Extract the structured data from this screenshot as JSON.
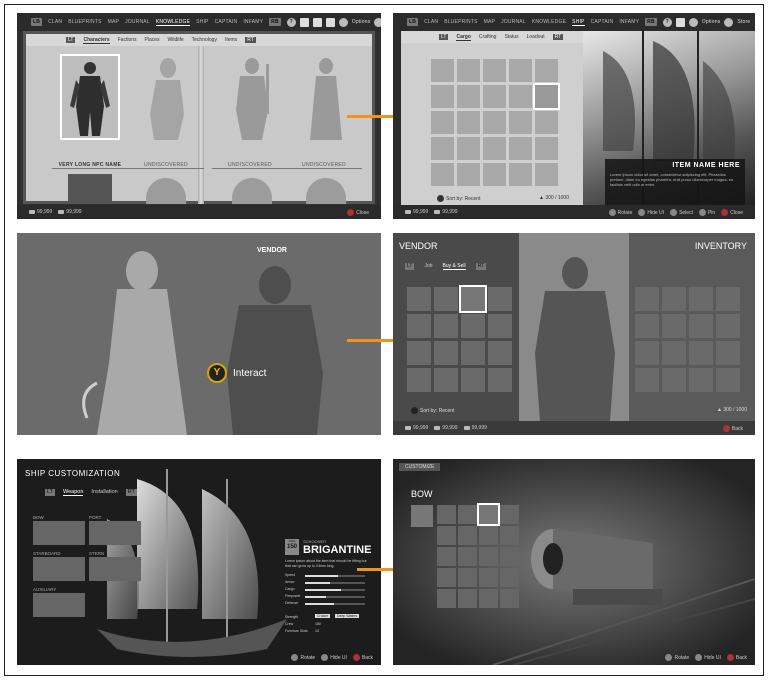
{
  "nav": {
    "lb": "LB",
    "rb": "RB",
    "items": [
      "CLAN",
      "BLUEPRINTS",
      "MAP",
      "JOURNAL",
      "KNOWLEDGE",
      "SHIP",
      "CAPTAIN",
      "INFAMY"
    ],
    "options": "Options",
    "store": "Store"
  },
  "knowledge": {
    "lt": "LT",
    "rt": "RT",
    "tabs": [
      "Characters",
      "Factions",
      "Places",
      "Wildlife",
      "Technology",
      "Items"
    ],
    "cards": [
      "VERY LONG NPC NAME",
      "UNDISCOVERED",
      "UNDISCOVERED",
      "UNDISCOVERED"
    ],
    "currency1": "99,999",
    "currency2": "99,999",
    "close": "Close"
  },
  "cargo": {
    "lt": "LT",
    "rt": "RT",
    "tabs": [
      "Cargo",
      "Crafting",
      "Status",
      "Loadout"
    ],
    "sort": "Sort by: Recent",
    "capacity": "300 / 1000",
    "item_name": "ITEM NAME HERE",
    "item_desc": "Lorem ipsum dolor sit amet, consectetur adipiscing elit. Phasellus pretium, diam eu egestas pharetra, erat purus ullamcorper magna, eu facilisis velit odio at enim.",
    "actions": [
      "Rotate",
      "Hide UI",
      "Select",
      "Pin",
      "Close"
    ],
    "currency1": "99,999",
    "currency2": "99,999"
  },
  "vendor_scene": {
    "title": "VENDOR",
    "interact_key": "Y",
    "interact": "Interact"
  },
  "vendor": {
    "title": "VENDOR",
    "inventory_title": "INVENTORY",
    "lt": "LT",
    "rt": "RT",
    "tabs": [
      "Job",
      "Buy & Sell"
    ],
    "sort": "Sort by: Recent",
    "capacity": "300 / 1000",
    "currency1": "99,999",
    "currency2": "99,999",
    "currency3": "99,999",
    "back": "Back"
  },
  "shipcust": {
    "title": "SHIP CUSTOMIZATION",
    "lt": "LT",
    "rt": "RT",
    "tabs": [
      "Weapon",
      "Installation"
    ],
    "slots": [
      "BOW",
      "PORT",
      "STARBOARD",
      "STERN",
      "AUXILIARY"
    ],
    "tier": "150",
    "tier_label": "TIER",
    "ship_class": "SCHOONER",
    "ship_name": "BRIGANTINE",
    "ship_desc": "Lorem ipsum about the item that should be fitting but that can grow up to 3 lines long.",
    "stats": [
      "Speed",
      "Armor",
      "Cargo",
      "Firepower",
      "Defense"
    ],
    "stat_values": [
      0.55,
      0.42,
      0.6,
      0.35,
      0.48
    ],
    "info_labels": [
      "Strength",
      "Crew",
      "Furniture Slots"
    ],
    "info_values": [
      "180",
      "10"
    ],
    "info_buttons": [
      "Cruiser",
      "Deep Waters"
    ],
    "actions": [
      "Rotate",
      "Hide UI",
      "Back"
    ]
  },
  "bow": {
    "customize": "CUSTOMIZE",
    "title": "BOW",
    "actions": [
      "Rotate",
      "Hide UI",
      "Back"
    ]
  },
  "colors": {
    "accent": "#f0931e",
    "close": "#aa3333"
  }
}
